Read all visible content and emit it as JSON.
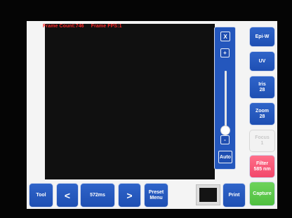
{
  "overlay": {
    "frame_count": "Frame Count:746",
    "frame_fps": "Frame FPS:1"
  },
  "zoom_panel": {
    "close_label": "X",
    "plus_label": "+",
    "minus_label": "-",
    "auto_label": "Auto",
    "slider_level": 0.0
  },
  "side_buttons": [
    {
      "label": "Epi-W"
    },
    {
      "label": "UV"
    },
    {
      "label": "Iris\n28"
    },
    {
      "label": "Zoom\n28"
    },
    {
      "label": "Focus\n1"
    },
    {
      "label": "Filter\n585 nm"
    },
    {
      "label": "Capture"
    }
  ],
  "toolbar": {
    "tool_label": "Tool",
    "prev_label": "<",
    "exposure_label": "572ms",
    "next_label": ">",
    "preset_label": "Preset\nMenu",
    "print_label": "Print"
  },
  "colors": {
    "button_blue": "#2457bd",
    "filter_pink": "#f2476b",
    "capture_green": "#4fbf3f",
    "overlay_red": "#ff2b2b"
  }
}
